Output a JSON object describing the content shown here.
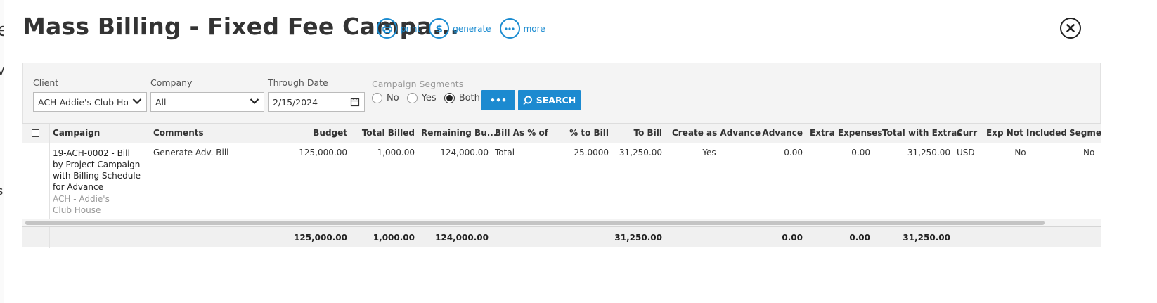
{
  "modal": {
    "title": "Mass Billing - Fixed Fee Campa...",
    "actions": [
      {
        "label": "print",
        "icon": "printer-icon"
      },
      {
        "label": "generate",
        "icon": "dollar-icon"
      },
      {
        "label": "more",
        "icon": "ellipsis-icon"
      }
    ]
  },
  "filters": {
    "client_label": "Client",
    "client_value": "ACH-Addie's Club House",
    "company_label": "Company",
    "company_value": "All",
    "through_date_label": "Through Date",
    "through_date_value": "2/15/2024",
    "segments_label": "Campaign Segments",
    "segments_options": [
      "No",
      "Yes",
      "Both"
    ],
    "segments_selected": "Both",
    "more_button": "•••",
    "search_button": "SEARCH"
  },
  "table": {
    "headers": {
      "campaign": "Campaign",
      "comments": "Comments",
      "budget": "Budget",
      "total_billed": "Total Billed",
      "remaining": "Remaining Bu...",
      "bill_as": "Bill As % of",
      "pct_to_bill": "% to Bill",
      "to_bill": "To Bill",
      "create_adv": "Create as Advance",
      "advance": "Advance",
      "extra": "Extra Expenses",
      "total_extras": "Total with Extras",
      "curr": "Curr",
      "exp_not_incl": "Exp Not Included",
      "segments": "Segme"
    },
    "rows": [
      {
        "campaign": "19-ACH-0002 - Bill by Project Campaign with Billing Schedule for Advance",
        "campaign_client": "ACH - Addie's Club House",
        "comments": "Generate Adv. Bill",
        "budget": "125,000.00",
        "total_billed": "1,000.00",
        "remaining": "124,000.00",
        "bill_as": "Total",
        "pct_to_bill": "25.0000",
        "to_bill": "31,250.00",
        "create_adv": "Yes",
        "advance": "0.00",
        "extra": "0.00",
        "total_extras": "31,250.00",
        "curr": "USD",
        "exp_not_incl": "No",
        "segments": "No"
      }
    ],
    "totals": {
      "budget": "125,000.00",
      "total_billed": "1,000.00",
      "remaining": "124,000.00",
      "to_bill": "31,250.00",
      "advance": "0.00",
      "extra": "0.00",
      "total_extras": "31,250.00"
    }
  },
  "colors": {
    "accent": "#1c8ad0",
    "header_bg": "#f2f2f2"
  }
}
